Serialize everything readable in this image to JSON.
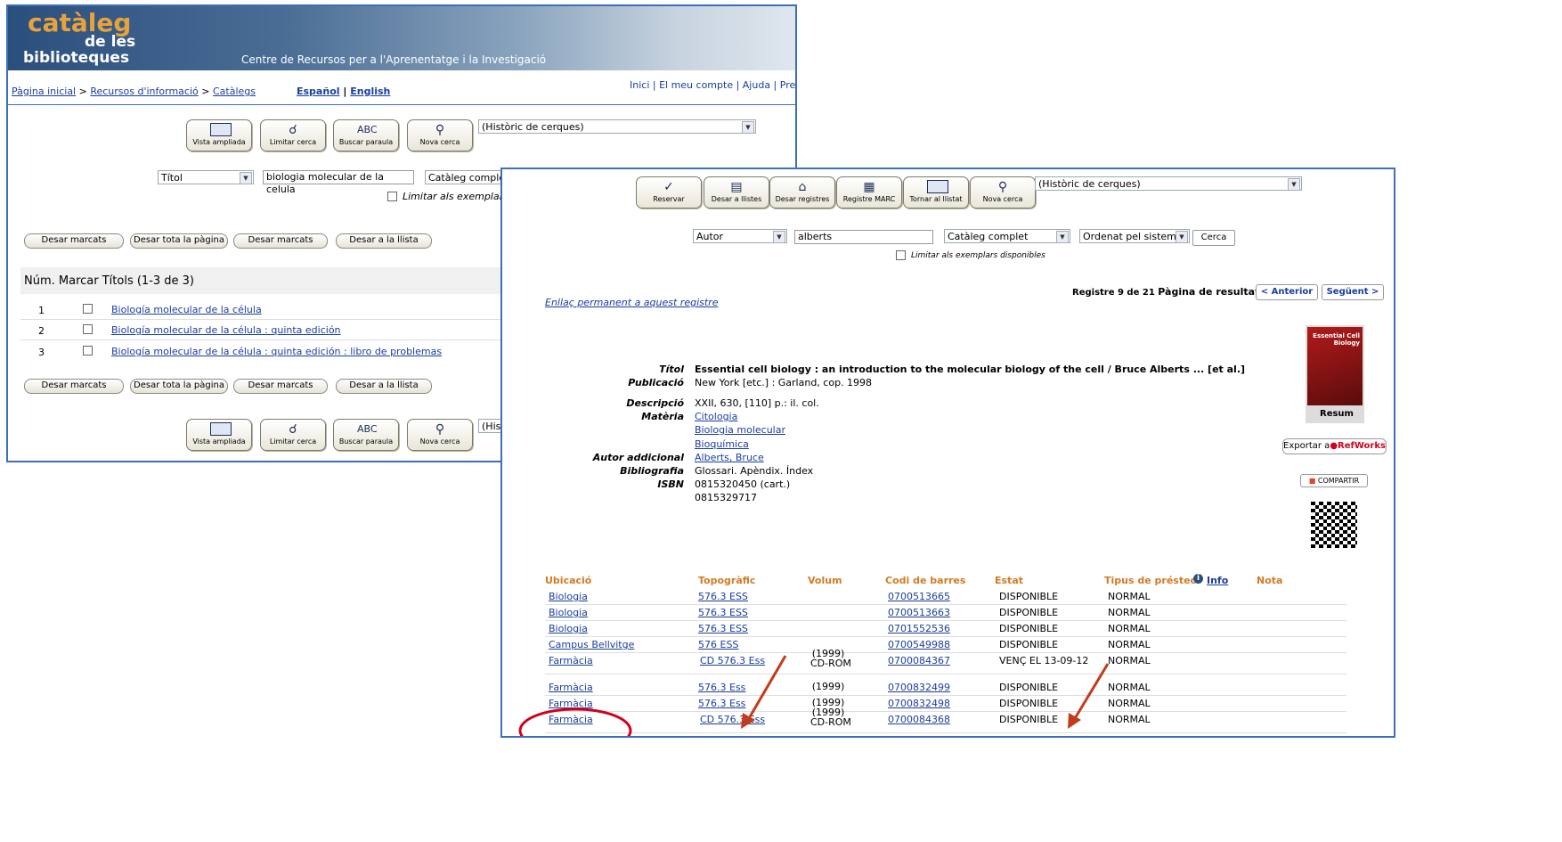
{
  "win1": {
    "logo": {
      "line1": "catàleg",
      "line2": "de les",
      "line3": "biblioteques"
    },
    "banner_text": "Centre de Recursos per a l'Aprenentatge i la Investigació",
    "breadcrumb": {
      "home": "Pàgina inicial",
      "sep1": " > ",
      "resources": "Recursos d'informació",
      "sep2": " > ",
      "catalogs": "Catàlegs"
    },
    "lang": {
      "es": "Español",
      "sep": " | ",
      "en": "English"
    },
    "toplinks": "Inici  |  El meu compte  |  Ajuda  |  Pre",
    "toolbar": [
      "Vista ampliada",
      "Limitar cerca",
      "Buscar paraula",
      "Nova cerca"
    ],
    "history_select": "(Històric de cerques)",
    "search_field": "Títol",
    "search_value": "biologia molecular de la celula",
    "catalog_select": "Catàleg complet",
    "limit_label": "Limitar als exemplar",
    "action_buttons": [
      "Desar marcats",
      "Desar tota la pàgina",
      "Desar marcats",
      "Desar a la llista"
    ],
    "results_header": "Núm. Marcar Títols (1-3 de 3)",
    "results": [
      {
        "num": "1",
        "title": "Biología molecular de la célula"
      },
      {
        "num": "2",
        "title": "Biología molecular de la célula : quinta edición"
      },
      {
        "num": "3",
        "title": "Biología molecular de la célula : quinta edición : libro de problemas"
      }
    ],
    "history_select_bottom": "(His"
  },
  "win2": {
    "toolbar": [
      "Reservar",
      "Desar a llistes",
      "Desar registres",
      "Registre MARC",
      "Tornar al llistat",
      "Nova cerca"
    ],
    "history_select": "(Històric de cerques)",
    "search_field": "Autor",
    "search_value": "alberts",
    "catalog_select": "Catàleg complet",
    "sort_select": "Ordenat pel sistema",
    "search_button": "Cerca",
    "limit_label": "Limitar als exemplars disponibles",
    "record_info": "Registre 9 de 21",
    "page_label": "Pàgina de resultats:",
    "prev": "< Anterior",
    "next": "Següent >",
    "permalink": "Enllaç permanent a aquest registre",
    "cover": {
      "title": "Essential Cell Biology",
      "caption": "Resum"
    },
    "fields": {
      "titol_label": "Títol",
      "titol": "Essential cell biology : an introduction to the molecular biology of the cell / Bruce Alberts ... [et al.]",
      "publicacio_label": "Publicació",
      "publicacio": "New York [etc.] : Garland, cop. 1998",
      "descripcio_label": "Descripció",
      "descripcio": "XXII, 630, [110] p.: il. col.",
      "materia_label": "Matèria",
      "materia": [
        "Citologia",
        "Biologia molecular",
        "Bioquímica"
      ],
      "autor_label": "Autor addicional",
      "autor": "Alberts, Bruce",
      "bibliografia_label": "Bibliografia",
      "bibliografia": "Glossari. Apèndix. Índex",
      "isbn_label": "ISBN",
      "isbn": [
        "0815320450 (cart.)",
        "0815329717"
      ]
    },
    "export_label": "Exportar a",
    "refworks": "RefWorks",
    "share_label": "COMPARTIR",
    "table": {
      "headers": [
        "Ubicació",
        "Topogràfic",
        "Volum",
        "Codi de barres",
        "Estat",
        "Tipus de préstec",
        "Info",
        "Nota"
      ],
      "rows": [
        {
          "ubicacio": "Biologia",
          "topo": "576.3 ESS",
          "volum": "",
          "volum2": "",
          "codi": "0700513665",
          "estat": "DISPONIBLE",
          "tipus": "NORMAL"
        },
        {
          "ubicacio": "Biologia",
          "topo": "576.3 ESS",
          "volum": "",
          "volum2": "",
          "codi": "0700513663",
          "estat": "DISPONIBLE",
          "tipus": "NORMAL"
        },
        {
          "ubicacio": "Biologia",
          "topo": "576.3 ESS",
          "volum": "",
          "volum2": "",
          "codi": "0701552536",
          "estat": "DISPONIBLE",
          "tipus": "NORMAL"
        },
        {
          "ubicacio": "Campus Bellvitge",
          "topo": "576 ESS",
          "volum": "",
          "volum2": "",
          "codi": "0700549988",
          "estat": "DISPONIBLE",
          "tipus": "NORMAL"
        },
        {
          "ubicacio": "Farmàcia",
          "topo": "CD 576.3 Ess",
          "volum": "(1999)",
          "volum2": "CD-ROM",
          "codi": "0700084367",
          "estat": "VENÇ EL 13-09-12",
          "tipus": "NORMAL"
        },
        {
          "ubicacio": "Farmàcia",
          "topo": "576.3 Ess",
          "volum": "(1999)",
          "volum2": "",
          "codi": "0700832499",
          "estat": "DISPONIBLE",
          "tipus": "NORMAL"
        },
        {
          "ubicacio": "Farmàcia",
          "topo": "576.3 Ess",
          "volum": "(1999)",
          "volum2": "",
          "codi": "0700832498",
          "estat": "DISPONIBLE",
          "tipus": "NORMAL"
        },
        {
          "ubicacio": "Farmàcia",
          "topo": "CD 576.3 Ess",
          "volum": "(1999)",
          "volum2": "CD-ROM",
          "codi": "0700084368",
          "estat": "DISPONIBLE",
          "tipus": "NORMAL"
        }
      ]
    }
  },
  "colors": {
    "border": "#3d6fb8",
    "link": "#1a3e9e",
    "header_orange": "#d47a22",
    "annotation_red": "#d0021b",
    "arrow": "#c23b1a"
  }
}
